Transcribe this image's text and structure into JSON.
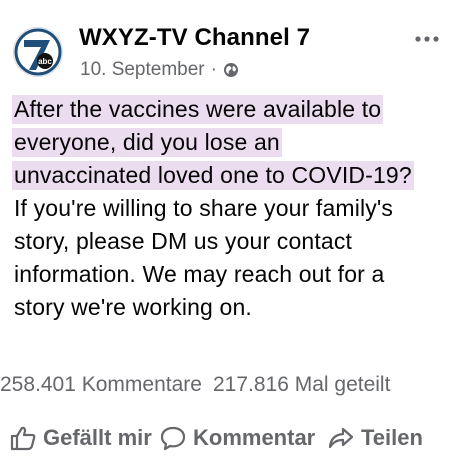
{
  "post": {
    "page_name": "WXYZ-TV Channel 7",
    "date": "10. September",
    "separator": "·",
    "privacy_icon": "globe-icon",
    "more_icon": "more-horizontal-icon",
    "avatar": {
      "digit": "7",
      "network": "abc",
      "colors": {
        "ring": "#1f4e79",
        "digit": "#1f4e79",
        "abc_bg": "#111111"
      }
    },
    "highlighted_lines": [
      "After the vaccines were available to",
      "everyone, did you lose an",
      "unvaccinated loved one to COVID-19?"
    ],
    "body_lines": [
      "If you're willing to share your family's",
      "story, please DM us your contact",
      "information. We may reach out for a",
      "story we're working on."
    ],
    "highlight_color": "#ecdcf0"
  },
  "stats": {
    "comments": "258.401 Kommentare",
    "shares": "217.816 Mal geteilt"
  },
  "actions": {
    "like_label": "Gefällt mir",
    "comment_label": "Kommentar",
    "share_label": "Teilen"
  }
}
